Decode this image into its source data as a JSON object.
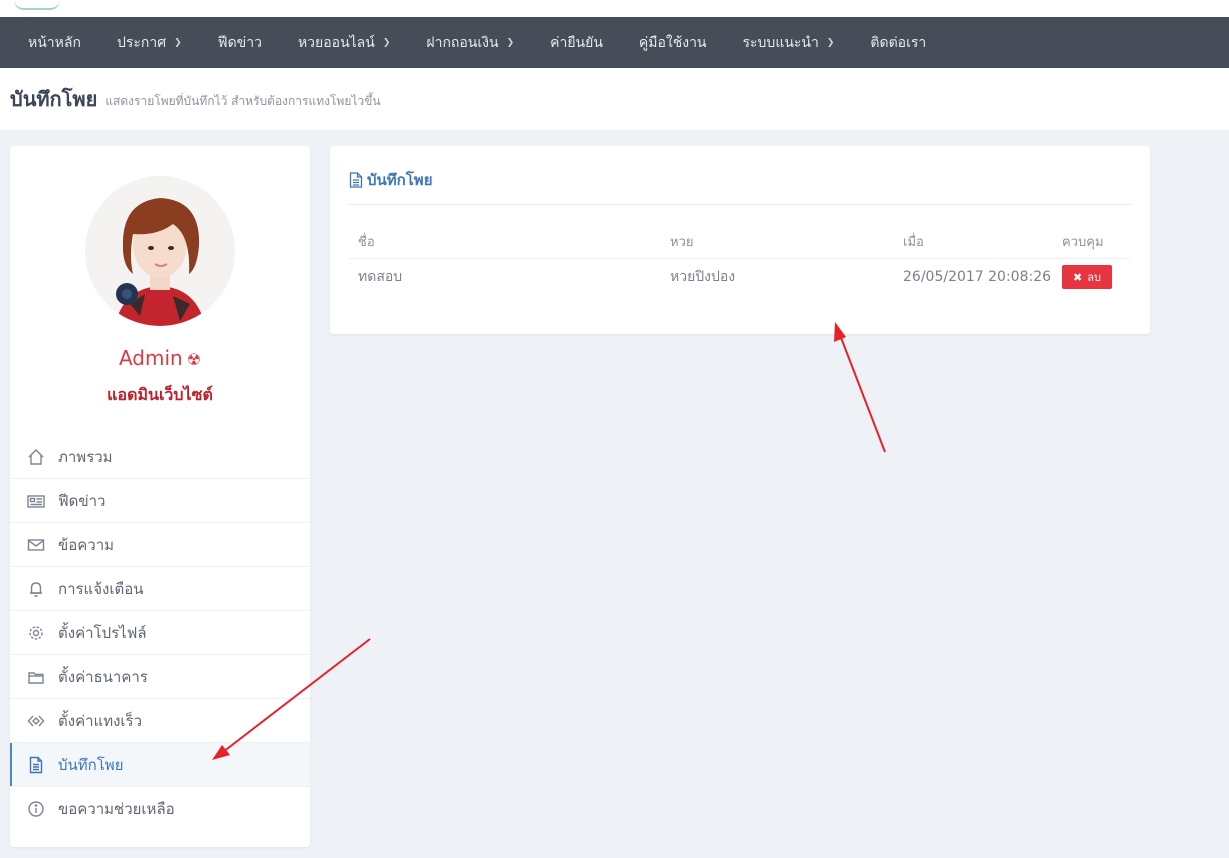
{
  "nav": {
    "items": [
      {
        "label": "หน้าหลัก",
        "dropdown": false
      },
      {
        "label": "ประกาศ",
        "dropdown": true
      },
      {
        "label": "ฟีดข่าว",
        "dropdown": false
      },
      {
        "label": "หวยออนไลน์",
        "dropdown": true
      },
      {
        "label": "ฝากถอนเงิน",
        "dropdown": true
      },
      {
        "label": "ค่ายืนยัน",
        "dropdown": false
      },
      {
        "label": "คู่มือใช้งาน",
        "dropdown": false
      },
      {
        "label": "ระบบแนะนำ",
        "dropdown": true
      },
      {
        "label": "ติดต่อเรา",
        "dropdown": false
      }
    ]
  },
  "page": {
    "title": "บันทึกโพย",
    "subtitle": "แสดงรายโพยที่บันทึกไว้ สำหรับต้องการแทงโพยไวขึ้น"
  },
  "profile": {
    "name": "Admin",
    "role": "แอดมินเว็บไซต์"
  },
  "sidebar": {
    "items": [
      {
        "label": "ภาพรวม",
        "icon": "home-icon",
        "active": false
      },
      {
        "label": "ฟีดข่าว",
        "icon": "newspaper-icon",
        "active": false
      },
      {
        "label": "ข้อความ",
        "icon": "mail-icon",
        "active": false
      },
      {
        "label": "การแจ้งเตือน",
        "icon": "bell-icon",
        "active": false
      },
      {
        "label": "ตั้งค่าโปรไฟล์",
        "icon": "gear-icon",
        "active": false
      },
      {
        "label": "ตั้งค่าธนาคาร",
        "icon": "wallet-icon",
        "active": false
      },
      {
        "label": "ตั้งค่าแทงเร็ว",
        "icon": "diamond-icon",
        "active": false
      },
      {
        "label": "บันทึกโพย",
        "icon": "document-icon",
        "active": true
      },
      {
        "label": "ขอความช่วยเหลือ",
        "icon": "info-icon",
        "active": false
      }
    ]
  },
  "card": {
    "title": "บันทึกโพย",
    "columns": [
      "ชื่อ",
      "หวย",
      "เมื่อ",
      "ควบคุม"
    ],
    "rows": [
      {
        "name": "ทดสอบ",
        "lottery": "หวยปิงปอง",
        "when": "26/05/2017 20:08:26",
        "action": "ลบ"
      }
    ]
  },
  "colors": {
    "navbar": "#464c58",
    "accent": "#3d76b8",
    "danger": "#e6353f",
    "annotation_arrow": "#e8202a"
  }
}
